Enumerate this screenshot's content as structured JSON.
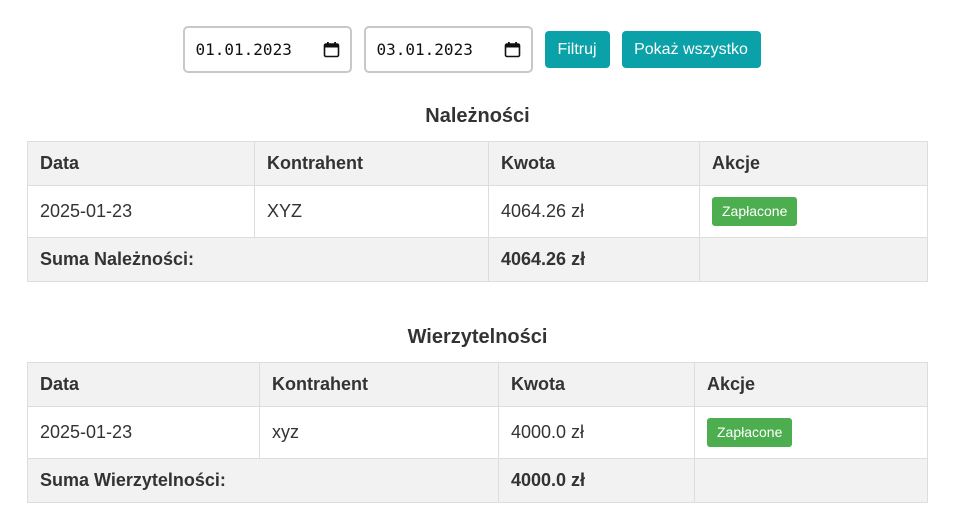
{
  "filter": {
    "date_from": "01.01.2023",
    "date_to": "03.01.2023",
    "filter_label": "Filtruj",
    "show_all_label": "Pokaż wszystko"
  },
  "receivables": {
    "title": "Należności",
    "headers": [
      "Data",
      "Kontrahent",
      "Kwota",
      "Akcje"
    ],
    "rows": [
      {
        "date": "2025-01-23",
        "contractor": "XYZ",
        "amount": "4064.26 zł",
        "action": "Zapłacone"
      }
    ],
    "sum_label": "Suma Należności:",
    "sum_value": "4064.26 zł"
  },
  "liabilities": {
    "title": "Wierzytelności",
    "headers": [
      "Data",
      "Kontrahent",
      "Kwota",
      "Akcje"
    ],
    "rows": [
      {
        "date": "2025-01-23",
        "contractor": "xyz",
        "amount": "4000.0 zł",
        "action": "Zapłacone"
      }
    ],
    "sum_label": "Suma Wierzytelności:",
    "sum_value": "4000.0 zł"
  },
  "colors": {
    "accent": "#0aa1a8",
    "paid_button": "#4cae4f",
    "header_bg": "#f2f2f2",
    "border": "#dddddd"
  }
}
